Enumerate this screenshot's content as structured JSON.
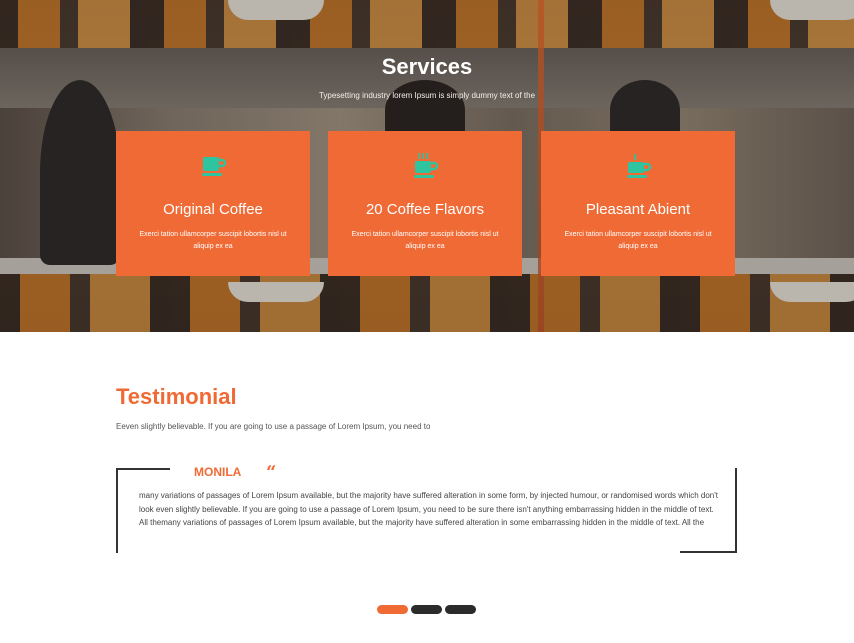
{
  "services": {
    "title": "Services",
    "subtitle": "Typesetting industry lorem Ipsum is simply dummy text of the",
    "cards": [
      {
        "icon": "coffee-cup-icon",
        "title": "Original Coffee",
        "text": "Exerci tation ullamcorper suscipit lobortis nisl ut aliquip ex ea"
      },
      {
        "icon": "hot-coffee-icon",
        "title": "20 Coffee Flavors",
        "text": "Exerci tation ullamcorper suscipit lobortis nisl ut aliquip ex ea"
      },
      {
        "icon": "coffee-cup-steam-icon",
        "title": "Pleasant Abient",
        "text": "Exerci tation ullamcorper suscipit lobortis nisl ut aliquip ex ea"
      }
    ]
  },
  "testimonial": {
    "title": "Testimonial",
    "subtitle": "Eeven slightly believable. If you are going to use a passage of Lorem Ipsum, you need to",
    "name": "MONILA",
    "quote_mark": "“",
    "body": "many variations of passages of Lorem Ipsum available, but the majority have suffered alteration in some form, by injected humour, or randomised words which don't look even slightly believable. If you are going to use a passage of Lorem Ipsum, you need to be sure there isn't anything embarrassing hidden in the middle of text. All themany variations of passages of Lorem Ipsum available, but the majority have suffered alteration in some embarrassing hidden in the middle of text. All the"
  },
  "carousel": {
    "slides": 3,
    "active": 1
  },
  "colors": {
    "accent": "#f06a35",
    "icon": "#2ec4a0",
    "dark": "#2b2b2b"
  }
}
